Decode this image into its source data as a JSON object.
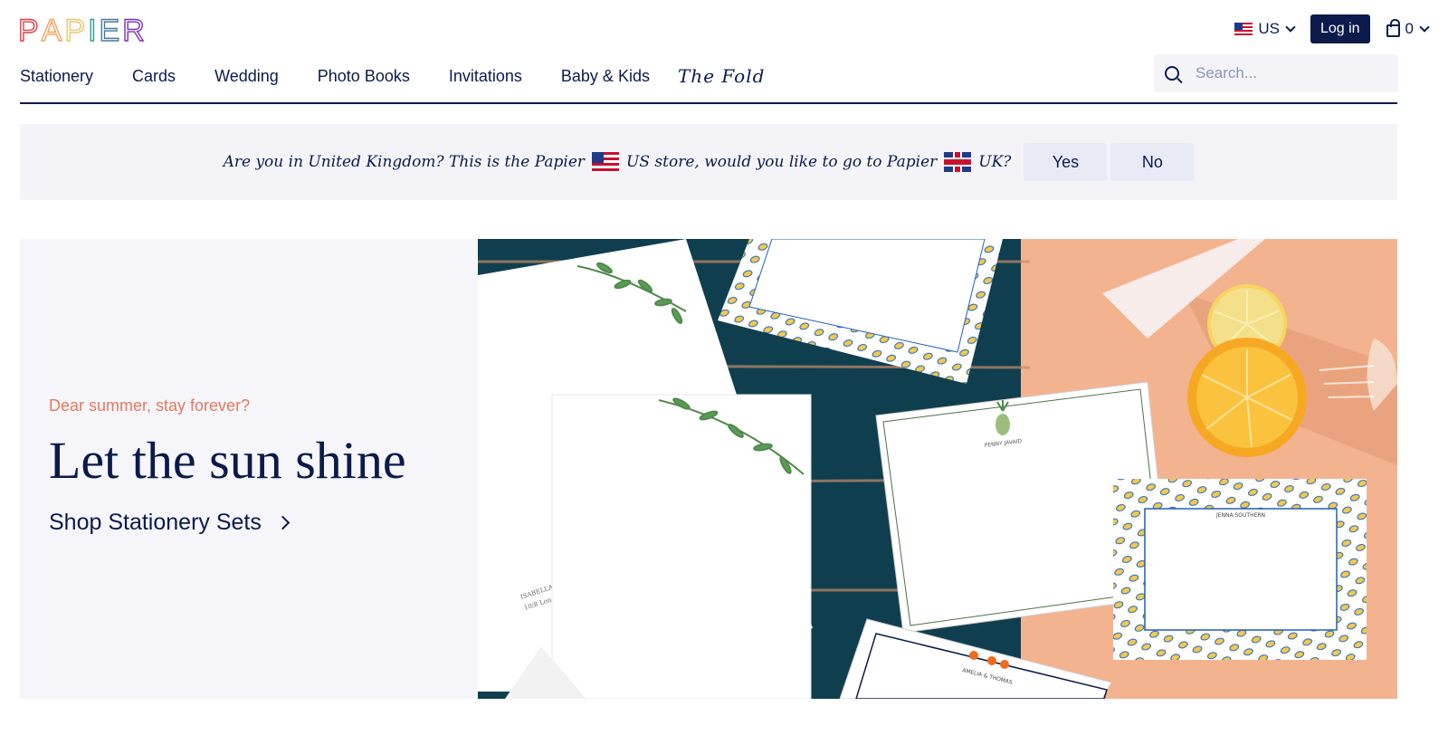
{
  "header": {
    "logo_text": "PAPIER",
    "logo_colors": [
      "#e63946",
      "#f4a261",
      "#e9c46a",
      "#2a9d8f",
      "#457b9d",
      "#7b2cbf"
    ],
    "region_label": "US",
    "login_label": "Log in",
    "cart_count": "0"
  },
  "nav": {
    "items": [
      "Stationery",
      "Cards",
      "Wedding",
      "Photo Books",
      "Invitations",
      "Baby & Kids"
    ],
    "fold_label": "The Fold"
  },
  "search": {
    "placeholder": "Search..."
  },
  "banner": {
    "text_part1": "Are you in United Kingdom? This is the Papier",
    "text_part2": "US store, would you like to go to Papier",
    "text_part3": "UK?",
    "yes_label": "Yes",
    "no_label": "No"
  },
  "hero": {
    "eyebrow": "Dear summer, stay forever?",
    "headline": "Let the sun shine",
    "cta_label": "Shop Stationery Sets",
    "card_names": [
      "PENNY JAVAID",
      "JENNA SOUTHERN",
      "AMELIA & THOMAS",
      "ISABELLA",
      "10/8 Lon"
    ]
  },
  "colors": {
    "navy": "#0b1a4a",
    "accent_coral": "#e07a5f",
    "tile_teal": "#0f3f4f",
    "peach": "#f3b38f"
  }
}
